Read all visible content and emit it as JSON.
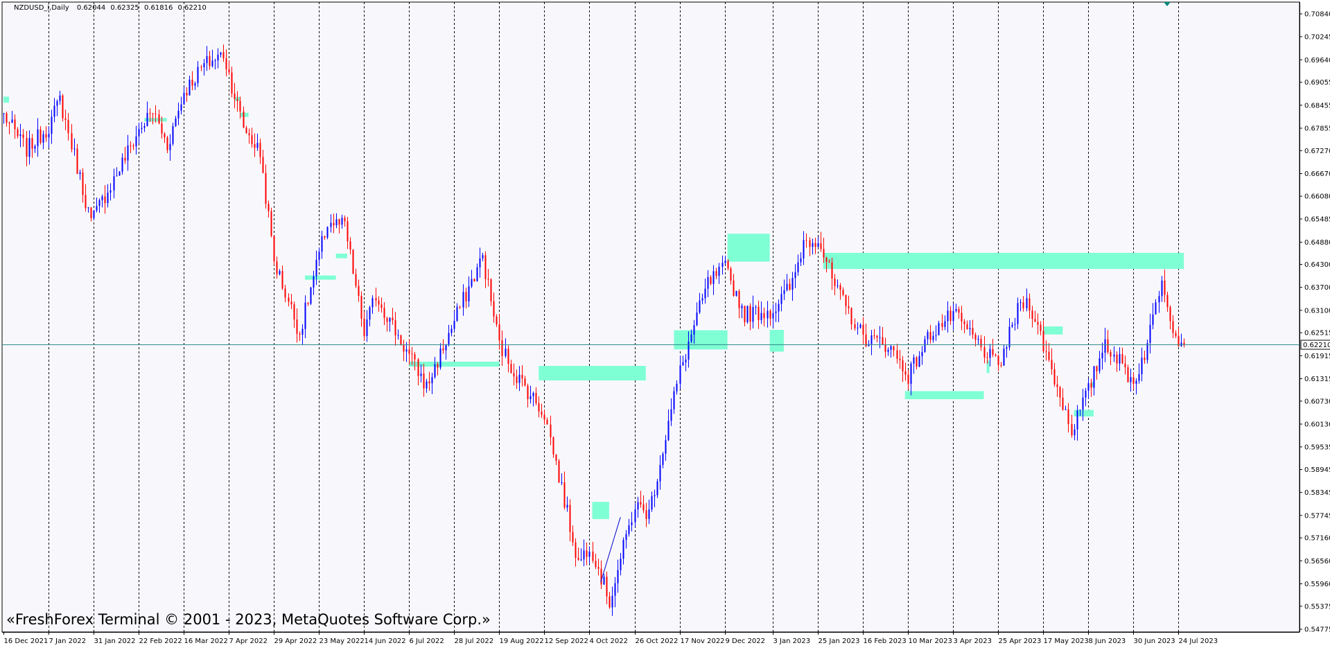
{
  "header": {
    "symbol": "NZDUSD_i,Daily",
    "open": "0.62044",
    "high": "0.62325",
    "low": "0.61816",
    "close": "0.62210"
  },
  "copyright": "«FreshForex Terminal © 2001 - 2023, MetaQuotes Software Corp.»",
  "colors": {
    "background": "#F8F8FC",
    "bull_candle": "#0000FF",
    "bear_candle": "#FF0000",
    "zone": "#7FFFD4",
    "bid_line": "#2E8B8B",
    "grid": "#000000"
  },
  "chart_data": {
    "type": "candlestick",
    "symbol": "NZDUSD_i",
    "timeframe": "Daily",
    "grid": "vertical dashed",
    "current_price": "0.62210",
    "ylim": [
      0.5477,
      0.7105
    ],
    "y_ticks": [
      "0.70840",
      "0.70245",
      "0.69640",
      "0.69055",
      "0.68455",
      "0.67855",
      "0.67270",
      "0.66670",
      "0.66080",
      "0.65485",
      "0.64880",
      "0.64300",
      "0.63700",
      "0.63100",
      "0.62515",
      "0.61915",
      "0.61315",
      "0.60730",
      "0.60130",
      "0.59535",
      "0.58945",
      "0.58345",
      "0.57745",
      "0.57160",
      "0.56560",
      "0.55960",
      "0.55375",
      "0.54775"
    ],
    "x_ticks": [
      "16 Dec 2021",
      "7 Jan 2022",
      "31 Jan 2022",
      "22 Feb 2022",
      "16 Mar 2022",
      "7 Apr 2022",
      "29 Apr 2022",
      "23 May 2022",
      "14 Jun 2022",
      "6 Jul 2022",
      "28 Jul 2022",
      "19 Aug 2022",
      "12 Sep 2022",
      "4 Oct 2022",
      "26 Oct 2022",
      "17 Nov 2022",
      "9 Dec 2022",
      "3 Jan 2023",
      "25 Jan 2023",
      "16 Feb 2023",
      "10 Mar 2023",
      "3 Apr 2023",
      "25 Apr 2023",
      "17 May 2023",
      "8 Jun 2023",
      "30 Jun 2023",
      "24 Jul 2023"
    ],
    "trend_anchors": [
      {
        "date": "16 Dec 2021",
        "price": 0.682
      },
      {
        "date": "28 Dec 2021",
        "price": 0.673
      },
      {
        "date": "7 Jan 2022",
        "price": 0.679
      },
      {
        "date": "13 Jan 2022",
        "price": 0.686
      },
      {
        "date": "28 Jan 2022",
        "price": 0.654
      },
      {
        "date": "22 Feb 2022",
        "price": 0.678
      },
      {
        "date": "1 Mar 2022",
        "price": 0.683
      },
      {
        "date": "8 Mar 2022",
        "price": 0.674
      },
      {
        "date": "16 Mar 2022",
        "price": 0.688
      },
      {
        "date": "25 Mar 2022",
        "price": 0.695
      },
      {
        "date": "5 Apr 2022",
        "price": 0.698
      },
      {
        "date": "14 Apr 2022",
        "price": 0.679
      },
      {
        "date": "22 Apr 2022",
        "price": 0.672
      },
      {
        "date": "29 Apr 2022",
        "price": 0.644
      },
      {
        "date": "12 May 2022",
        "price": 0.625
      },
      {
        "date": "26 May 2022",
        "price": 0.654
      },
      {
        "date": "3 Jun 2022",
        "price": 0.653
      },
      {
        "date": "14 Jun 2022",
        "price": 0.625
      },
      {
        "date": "20 Jun 2022",
        "price": 0.635
      },
      {
        "date": "14 Jul 2022",
        "price": 0.611
      },
      {
        "date": "28 Jul 2022",
        "price": 0.628
      },
      {
        "date": "1 Aug 2022",
        "price": 0.632
      },
      {
        "date": "11 Aug 2022",
        "price": 0.645
      },
      {
        "date": "19 Aug 2022",
        "price": 0.622
      },
      {
        "date": "26 Aug 2022",
        "price": 0.615
      },
      {
        "date": "12 Sep 2022",
        "price": 0.604
      },
      {
        "date": "28 Sep 2022",
        "price": 0.565
      },
      {
        "date": "4 Oct 2022",
        "price": 0.57
      },
      {
        "date": "13 Oct 2022",
        "price": 0.555
      },
      {
        "date": "26 Oct 2022",
        "price": 0.58
      },
      {
        "date": "2 Nov 2022",
        "price": 0.578
      },
      {
        "date": "17 Nov 2022",
        "price": 0.615
      },
      {
        "date": "24 Nov 2022",
        "price": 0.627
      },
      {
        "date": "1 Dec 2022",
        "price": 0.638
      },
      {
        "date": "9 Dec 2022",
        "price": 0.642
      },
      {
        "date": "20 Dec 2022",
        "price": 0.63
      },
      {
        "date": "3 Jan 2023",
        "price": 0.631
      },
      {
        "date": "12 Jan 2023",
        "price": 0.638
      },
      {
        "date": "18 Jan 2023",
        "price": 0.649
      },
      {
        "date": "25 Jan 2023",
        "price": 0.65
      },
      {
        "date": "2 Feb 2023",
        "price": 0.637
      },
      {
        "date": "16 Feb 2023",
        "price": 0.624
      },
      {
        "date": "1 Mar 2023",
        "price": 0.622
      },
      {
        "date": "10 Mar 2023",
        "price": 0.614
      },
      {
        "date": "22 Mar 2023",
        "price": 0.625
      },
      {
        "date": "3 Apr 2023",
        "price": 0.63
      },
      {
        "date": "12 Apr 2023",
        "price": 0.624
      },
      {
        "date": "25 Apr 2023",
        "price": 0.616
      },
      {
        "date": "5 May 2023",
        "price": 0.633
      },
      {
        "date": "10 May 2023",
        "price": 0.633
      },
      {
        "date": "17 May 2023",
        "price": 0.622
      },
      {
        "date": "31 May 2023",
        "price": 0.6
      },
      {
        "date": "8 Jun 2023",
        "price": 0.61
      },
      {
        "date": "16 Jun 2023",
        "price": 0.623
      },
      {
        "date": "30 Jun 2023",
        "price": 0.612
      },
      {
        "date": "7 Jul 2023",
        "price": 0.622
      },
      {
        "date": "14 Jul 2023",
        "price": 0.64
      },
      {
        "date": "21 Jul 2023",
        "price": 0.624
      },
      {
        "date": "26 Jul 2023",
        "price": 0.6221
      }
    ],
    "zones": [
      {
        "start": "16 Dec 2021",
        "end": "20 Dec 2021",
        "top": 0.6868,
        "bottom": 0.6852
      },
      {
        "start": "24 Feb 2022",
        "end": "8 Mar 2022",
        "top": 0.6812,
        "bottom": 0.6803
      },
      {
        "start": "11 Apr 2022",
        "end": "13 Apr 2022",
        "top": 0.6867,
        "bottom": 0.6857
      },
      {
        "start": "13 Apr 2022",
        "end": "18 Apr 2022",
        "top": 0.6826,
        "bottom": 0.6815
      },
      {
        "start": "16 May 2022",
        "end": "31 May 2022",
        "top": 0.6401,
        "bottom": 0.639
      },
      {
        "start": "31 May 2022",
        "end": "6 Jun 2022",
        "top": 0.6458,
        "bottom": 0.6446
      },
      {
        "start": "6 Jul 2022",
        "end": "19 Aug 2022",
        "top": 0.6176,
        "bottom": 0.6163
      },
      {
        "start": "8 Sep 2022",
        "end": "1 Nov 2022",
        "top": 0.6165,
        "bottom": 0.6127
      },
      {
        "start": "5 Oct 2022",
        "end": "13 Oct 2022",
        "top": 0.581,
        "bottom": 0.5765
      },
      {
        "start": "15 Nov 2022",
        "end": "12 Dec 2022",
        "top": 0.6258,
        "bottom": 0.6208
      },
      {
        "start": "12 Dec 2022",
        "end": "2 Jan 2023",
        "top": 0.651,
        "bottom": 0.6437
      },
      {
        "start": "2 Jan 2023",
        "end": "9 Jan 2023",
        "top": 0.6259,
        "bottom": 0.6202
      },
      {
        "start": "27 Jan 2023",
        "end": "26 Jul 2023",
        "top": 0.646,
        "bottom": 0.6418
      },
      {
        "start": "9 Mar 2023",
        "end": "18 Apr 2023",
        "top": 0.6099,
        "bottom": 0.6078
      },
      {
        "start": "19 Apr 2023",
        "end": "20 Apr 2023",
        "top": 0.6179,
        "bottom": 0.6146
      },
      {
        "start": "17 May 2023",
        "end": "26 May 2023",
        "top": 0.6268,
        "bottom": 0.6247
      },
      {
        "start": "1 Jun 2023",
        "end": "12 Jun 2023",
        "top": 0.605,
        "bottom": 0.6033
      },
      {
        "start": "9 Jun 2023",
        "end": "12 Jun 2023",
        "top": 0.6123,
        "bottom": 0.611
      }
    ],
    "trendline": {
      "start_date": "10 Oct 2022",
      "start_price": 0.56,
      "end_date": "19 Oct 2022",
      "end_price": 0.577
    }
  }
}
